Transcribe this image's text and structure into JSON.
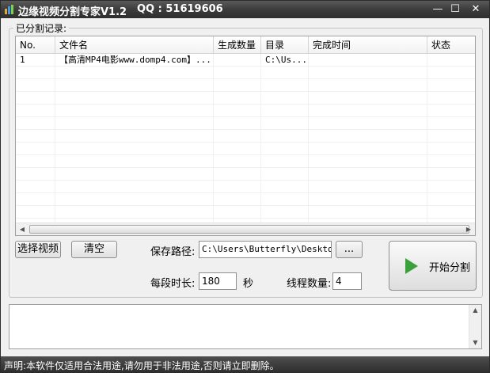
{
  "window": {
    "title": "边缘视频分割专家V1.2",
    "qq": "QQ : 51619606",
    "min_glyph": "—",
    "max_glyph": "☐",
    "close_glyph": "✕"
  },
  "records": {
    "group_label": "已分割记录:",
    "columns": [
      "No.",
      "文件名",
      "生成数量",
      "目录",
      "完成时间",
      "状态"
    ],
    "rows": [
      {
        "no": "1",
        "filename": "【高清MP4电影www.domp4.com】...",
        "count": "",
        "dir": "C:\\Us...",
        "time": "",
        "status": ""
      }
    ]
  },
  "controls": {
    "select_video_label": "选择视频",
    "clear_label": "清空",
    "save_path_label": "保存路径:",
    "save_path_value": "C:\\Users\\Butterfly\\Desktop\\",
    "browse_label": "...",
    "segment_duration_label": "每段时长:",
    "segment_duration_value": "180",
    "seconds_unit": "秒",
    "thread_count_label": "线程数量:",
    "thread_count_value": "4",
    "start_label": "开始分割"
  },
  "statusbar": {
    "text": "声明:本软件仅适用合法用途,请勿用于非法用途,否则请立即删除。"
  },
  "colors": {
    "play_icon": "#3aa03a",
    "titlebar": "#3c3c3c"
  }
}
